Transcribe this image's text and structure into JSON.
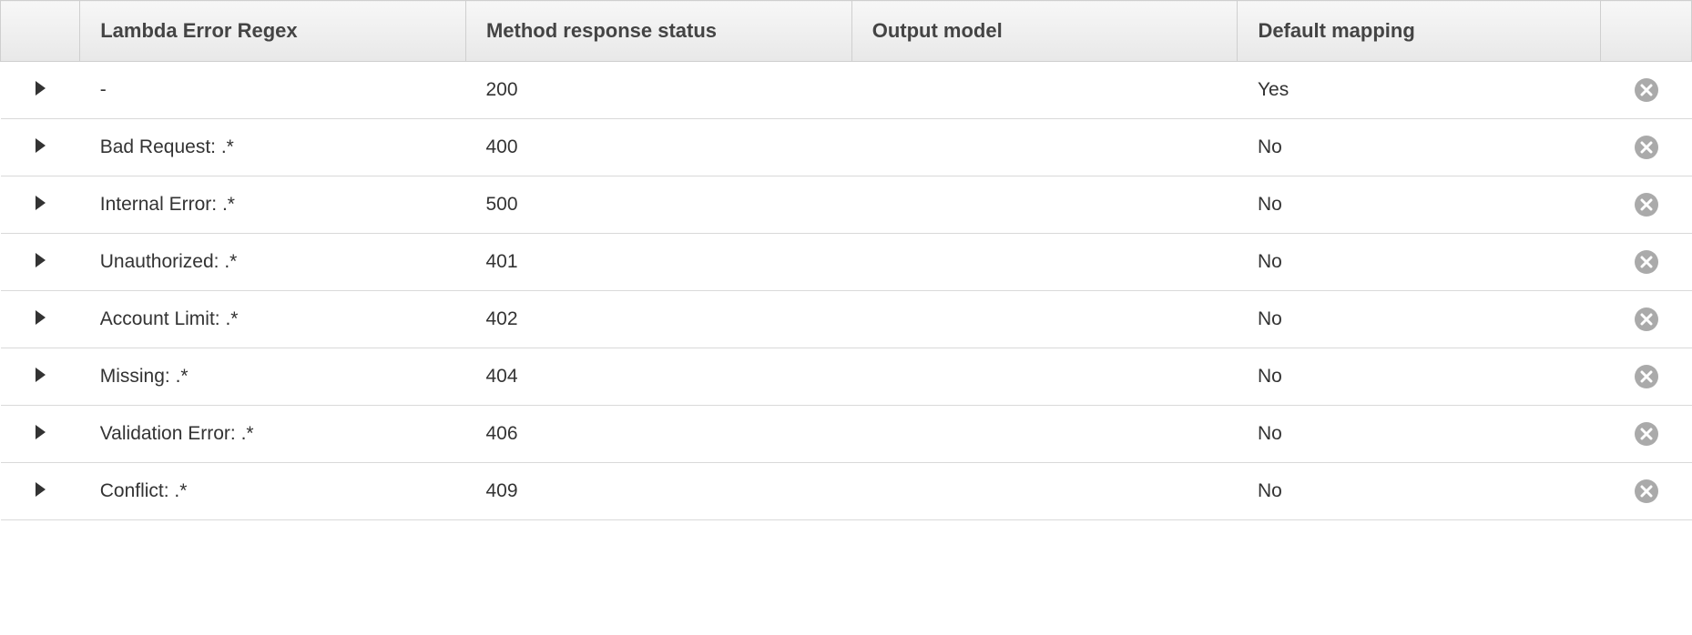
{
  "headers": {
    "expand": "",
    "regex": "Lambda Error Regex",
    "status": "Method response status",
    "output": "Output model",
    "default_mapping": "Default mapping",
    "actions": ""
  },
  "rows": [
    {
      "regex": "-",
      "status": "200",
      "output": "",
      "default_mapping": "Yes"
    },
    {
      "regex": "Bad Request: .*",
      "status": "400",
      "output": "",
      "default_mapping": "No"
    },
    {
      "regex": "Internal Error: .*",
      "status": "500",
      "output": "",
      "default_mapping": "No"
    },
    {
      "regex": "Unauthorized: .*",
      "status": "401",
      "output": "",
      "default_mapping": "No"
    },
    {
      "regex": "Account Limit: .*",
      "status": "402",
      "output": "",
      "default_mapping": "No"
    },
    {
      "regex": "Missing: .*",
      "status": "404",
      "output": "",
      "default_mapping": "No"
    },
    {
      "regex": "Validation Error: .*",
      "status": "406",
      "output": "",
      "default_mapping": "No"
    },
    {
      "regex": "Conflict: .*",
      "status": "409",
      "output": "",
      "default_mapping": "No"
    }
  ]
}
